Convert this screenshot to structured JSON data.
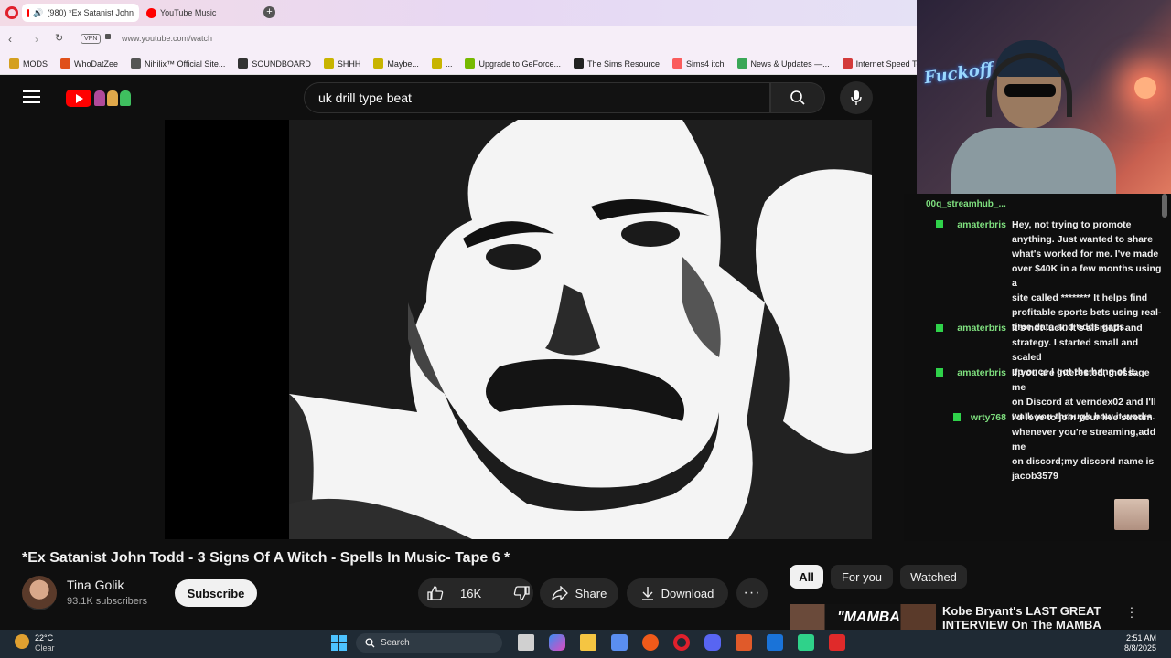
{
  "browser": {
    "tabs": [
      {
        "label": "(980) *Ex Satanist John",
        "active": true
      },
      {
        "label": "YouTube Music",
        "active": false
      }
    ],
    "vpn_label": "VPN",
    "url": "www.youtube.com/watch",
    "bookmarks": [
      {
        "label": "MODS",
        "color": "#d4a020"
      },
      {
        "label": "WhoDatZee",
        "color": "#e0501a"
      },
      {
        "label": "Nihilix™ Official Site...",
        "color": "#555555"
      },
      {
        "label": "SOUNDBOARD",
        "color": "#333333"
      },
      {
        "label": "SHHH",
        "color": "#c8b400"
      },
      {
        "label": "Maybe...",
        "color": "#c8b400"
      },
      {
        "label": "...",
        "color": "#c8b400"
      },
      {
        "label": "Upgrade to GeForce...",
        "color": "#76b900"
      },
      {
        "label": "The Sims Resource",
        "color": "#222222"
      },
      {
        "label": "Sims4 itch",
        "color": "#fa5c5c"
      },
      {
        "label": "News & Updates —...",
        "color": "#3aa757"
      },
      {
        "label": "Internet Speed Test...",
        "color": "#d33a3a"
      }
    ]
  },
  "youtube": {
    "search_query": "uk drill type beat",
    "video_title": "*Ex Satanist John Todd - 3 Signs Of A Witch - Spells In Music- Tape 6 *",
    "channel_name": "Tina Golik",
    "subscribers": "93.1K subscribers",
    "subscribe_label": "Subscribe",
    "like_count": "16K",
    "share_label": "Share",
    "download_label": "Download",
    "filter_chips": [
      "All",
      "For you",
      "Watched"
    ],
    "up_next_title": "Kobe Bryant's LAST GREAT INTERVIEW On The MAMBA",
    "up_next_thumb_text": "\"MAMBA"
  },
  "stream": {
    "webcam_overlay_text": "Fuckoff",
    "chat_header_user": "00q_streamhub_...",
    "chat": [
      {
        "user": "amaterbris",
        "lines": [
          "Hey, not trying to promote",
          "anything. Just wanted to share",
          "what's worked for me. I've made",
          "over $40K in a few months using a",
          "site called ******** It helps find",
          "profitable sports bets using real-",
          "time data and odds gaps."
        ]
      },
      {
        "user": "amaterbris",
        "lines": [
          "It's not luck. It's all math and",
          "strategy. I started small and scaled",
          "up once I got the hang of it."
        ]
      },
      {
        "user": "amaterbris",
        "lines": [
          "If you are interested, message me",
          "on Discord at verndex02 and I'll",
          "walk you through how it works."
        ]
      },
      {
        "user": "wrty768",
        "lines": [
          "i'd love to join your live stream",
          "whenever you're streaming,add me",
          "on discord;my discord name is",
          "jacob3579"
        ]
      }
    ]
  },
  "taskbar": {
    "weather_temp": "22°C",
    "weather_desc": "Clear",
    "search_label": "Search",
    "time": "2:51 AM",
    "date": "8/8/2025"
  },
  "colors": {
    "yt_red": "#ff0000",
    "subscribe_bg": "#f1f1f1",
    "chip_active_bg": "#f1f1f1",
    "chat_user": "#7fe07f"
  }
}
